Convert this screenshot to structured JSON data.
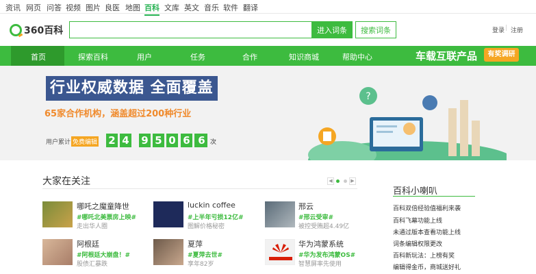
{
  "topnav": {
    "items": [
      "资讯",
      "网页",
      "问答",
      "视频",
      "图片",
      "良医",
      "地图",
      "百科",
      "文库",
      "英文",
      "音乐",
      "软件",
      "翻译"
    ],
    "active": "百科"
  },
  "header": {
    "logo_text": "360百科",
    "search_placeholder": "",
    "enter_button": "进入词条",
    "search_button": "搜索词条",
    "login": "登录",
    "separator": "|",
    "register": "注册"
  },
  "nav": {
    "items": [
      "首页",
      "探索百科",
      "用户",
      "任务",
      "合作",
      "知识商城",
      "帮助中心"
    ],
    "promo": "车载互联产品",
    "promo_badge": "有奖调研"
  },
  "banner": {
    "title": "行业权威数据 全面覆盖",
    "subtitle": "65家合作机构，涵盖超过200种行业",
    "users_label": "用户累计",
    "free_edit": "免费编辑",
    "digits": [
      "2",
      "4",
      "9",
      "5",
      "0",
      "6",
      "3",
      "6"
    ],
    "unit": "次"
  },
  "section": {
    "title": "大家在关注"
  },
  "cards": [
    {
      "title": "哪吒之魔童降世",
      "tag": "#哪吒北美票房上映#",
      "desc": "走出华人圈"
    },
    {
      "title": "luckin coffee",
      "tag": "#上半年亏损12亿#",
      "desc": "图解价格秘密"
    },
    {
      "title": "邢云",
      "tag": "#邢云受审#",
      "desc": "被控受贿超4.49亿"
    },
    {
      "title": "阿根廷",
      "tag": "#阿根廷大崩盘！#",
      "desc": "股债汇暴跌"
    },
    {
      "title": "夏萍",
      "tag": "#夏萍去世#",
      "desc": "享年82岁"
    },
    {
      "title": "华为鸿蒙系统",
      "tag": "#华为发布鸿蒙OS#",
      "desc": "智慧屏率先使用"
    }
  ],
  "sidebar": {
    "title": "百科小喇叭",
    "links": [
      "百科双倍经验值福利来袭",
      "百科飞幕功能上线",
      "未通过版本查看功能上线",
      "词条编辑权限更改",
      "百科新玩法：上榜有奖",
      "编辑得金币，商城送好礼"
    ]
  },
  "colors": {
    "brand_green": "#3dbb3f",
    "dark_green": "#2e9a2c",
    "orange": "#f5a623",
    "banner_blue": "#3b5790"
  }
}
